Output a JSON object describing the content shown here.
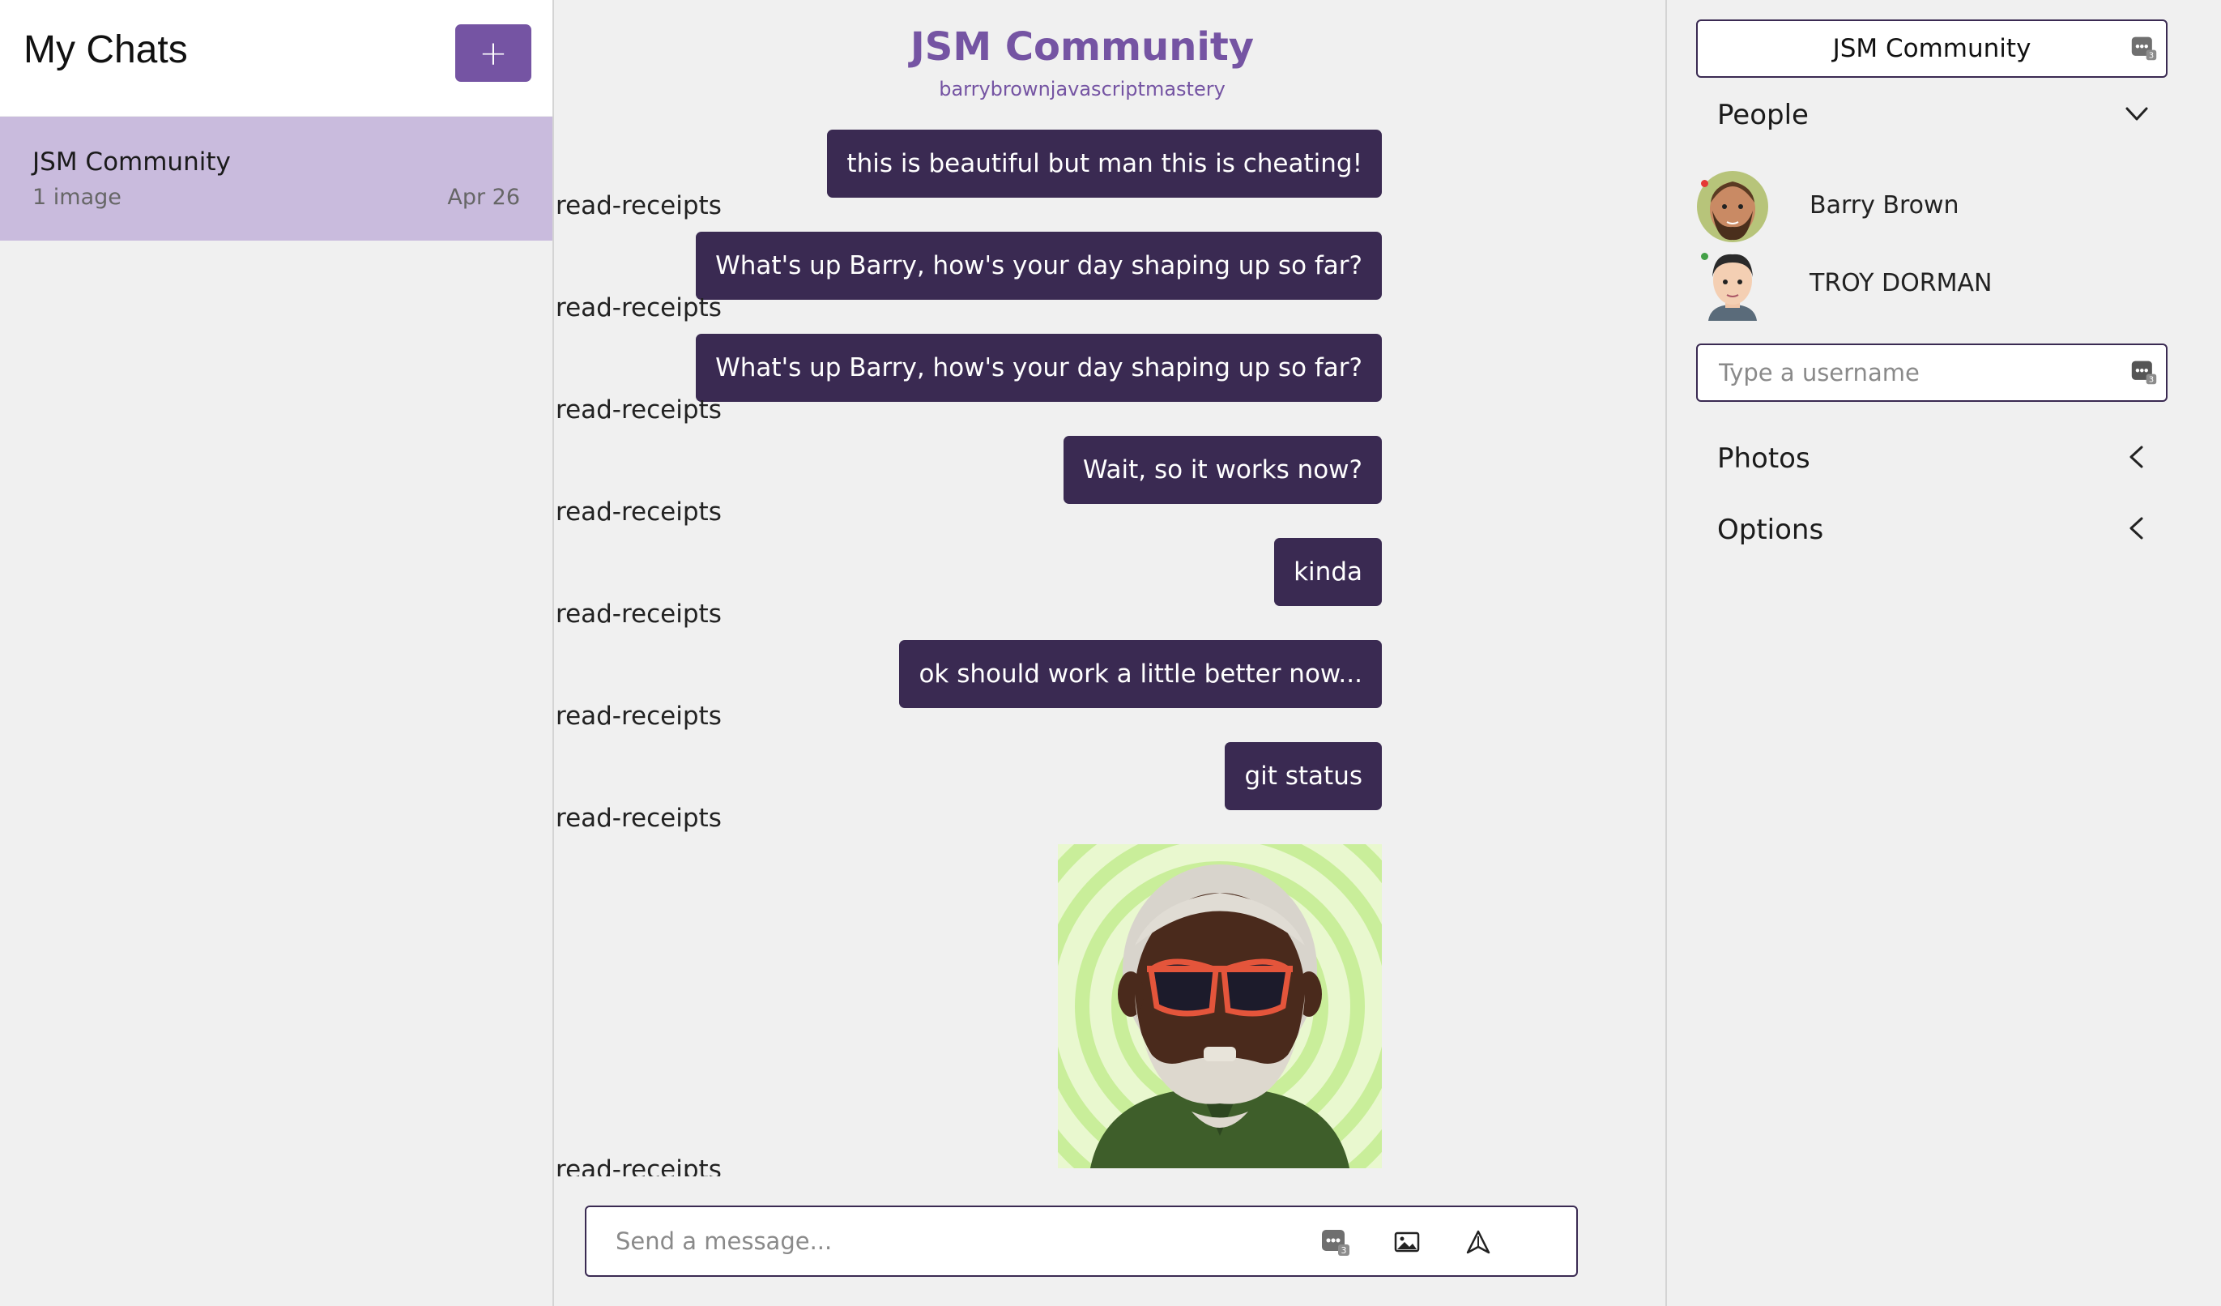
{
  "sidebar": {
    "title": "My Chats",
    "new_chat_label": "+",
    "chats": [
      {
        "title": "JSM Community",
        "subtitle": "1 image",
        "date": "Apr 26"
      }
    ]
  },
  "feed": {
    "title": "JSM Community",
    "subtitle": "barrybrownjavascriptmastery",
    "read_receipt_label": "read-receipts",
    "messages": [
      {
        "text": "this is beautiful but man this is cheating!"
      },
      {
        "text": "What's up Barry, how's your day shaping up so far?"
      },
      {
        "text": "What's up Barry, how's your day shaping up so far?"
      },
      {
        "text": "Wait, so it works now?"
      },
      {
        "text": "kinda"
      },
      {
        "text": "ok should work a little better now..."
      },
      {
        "text": "git status"
      }
    ],
    "composer": {
      "placeholder": "Send a message..."
    }
  },
  "settings": {
    "chat_title": "JSM Community",
    "people_header": "People",
    "people": [
      {
        "name": "Barry Brown",
        "status_color": "#e53935"
      },
      {
        "name": "TROY DORMAN",
        "status_color": "#43a047"
      }
    ],
    "username_placeholder": "Type a username",
    "photos_header": "Photos",
    "options_header": "Options"
  },
  "colors": {
    "accent": "#7554a3",
    "bubble": "#3a2a52",
    "selected_chat": "#c9bbdd"
  },
  "icons": [
    "grammarly-icon",
    "image-icon",
    "send-icon",
    "chevron-down-icon",
    "chevron-left-icon",
    "avatar-icon"
  ]
}
